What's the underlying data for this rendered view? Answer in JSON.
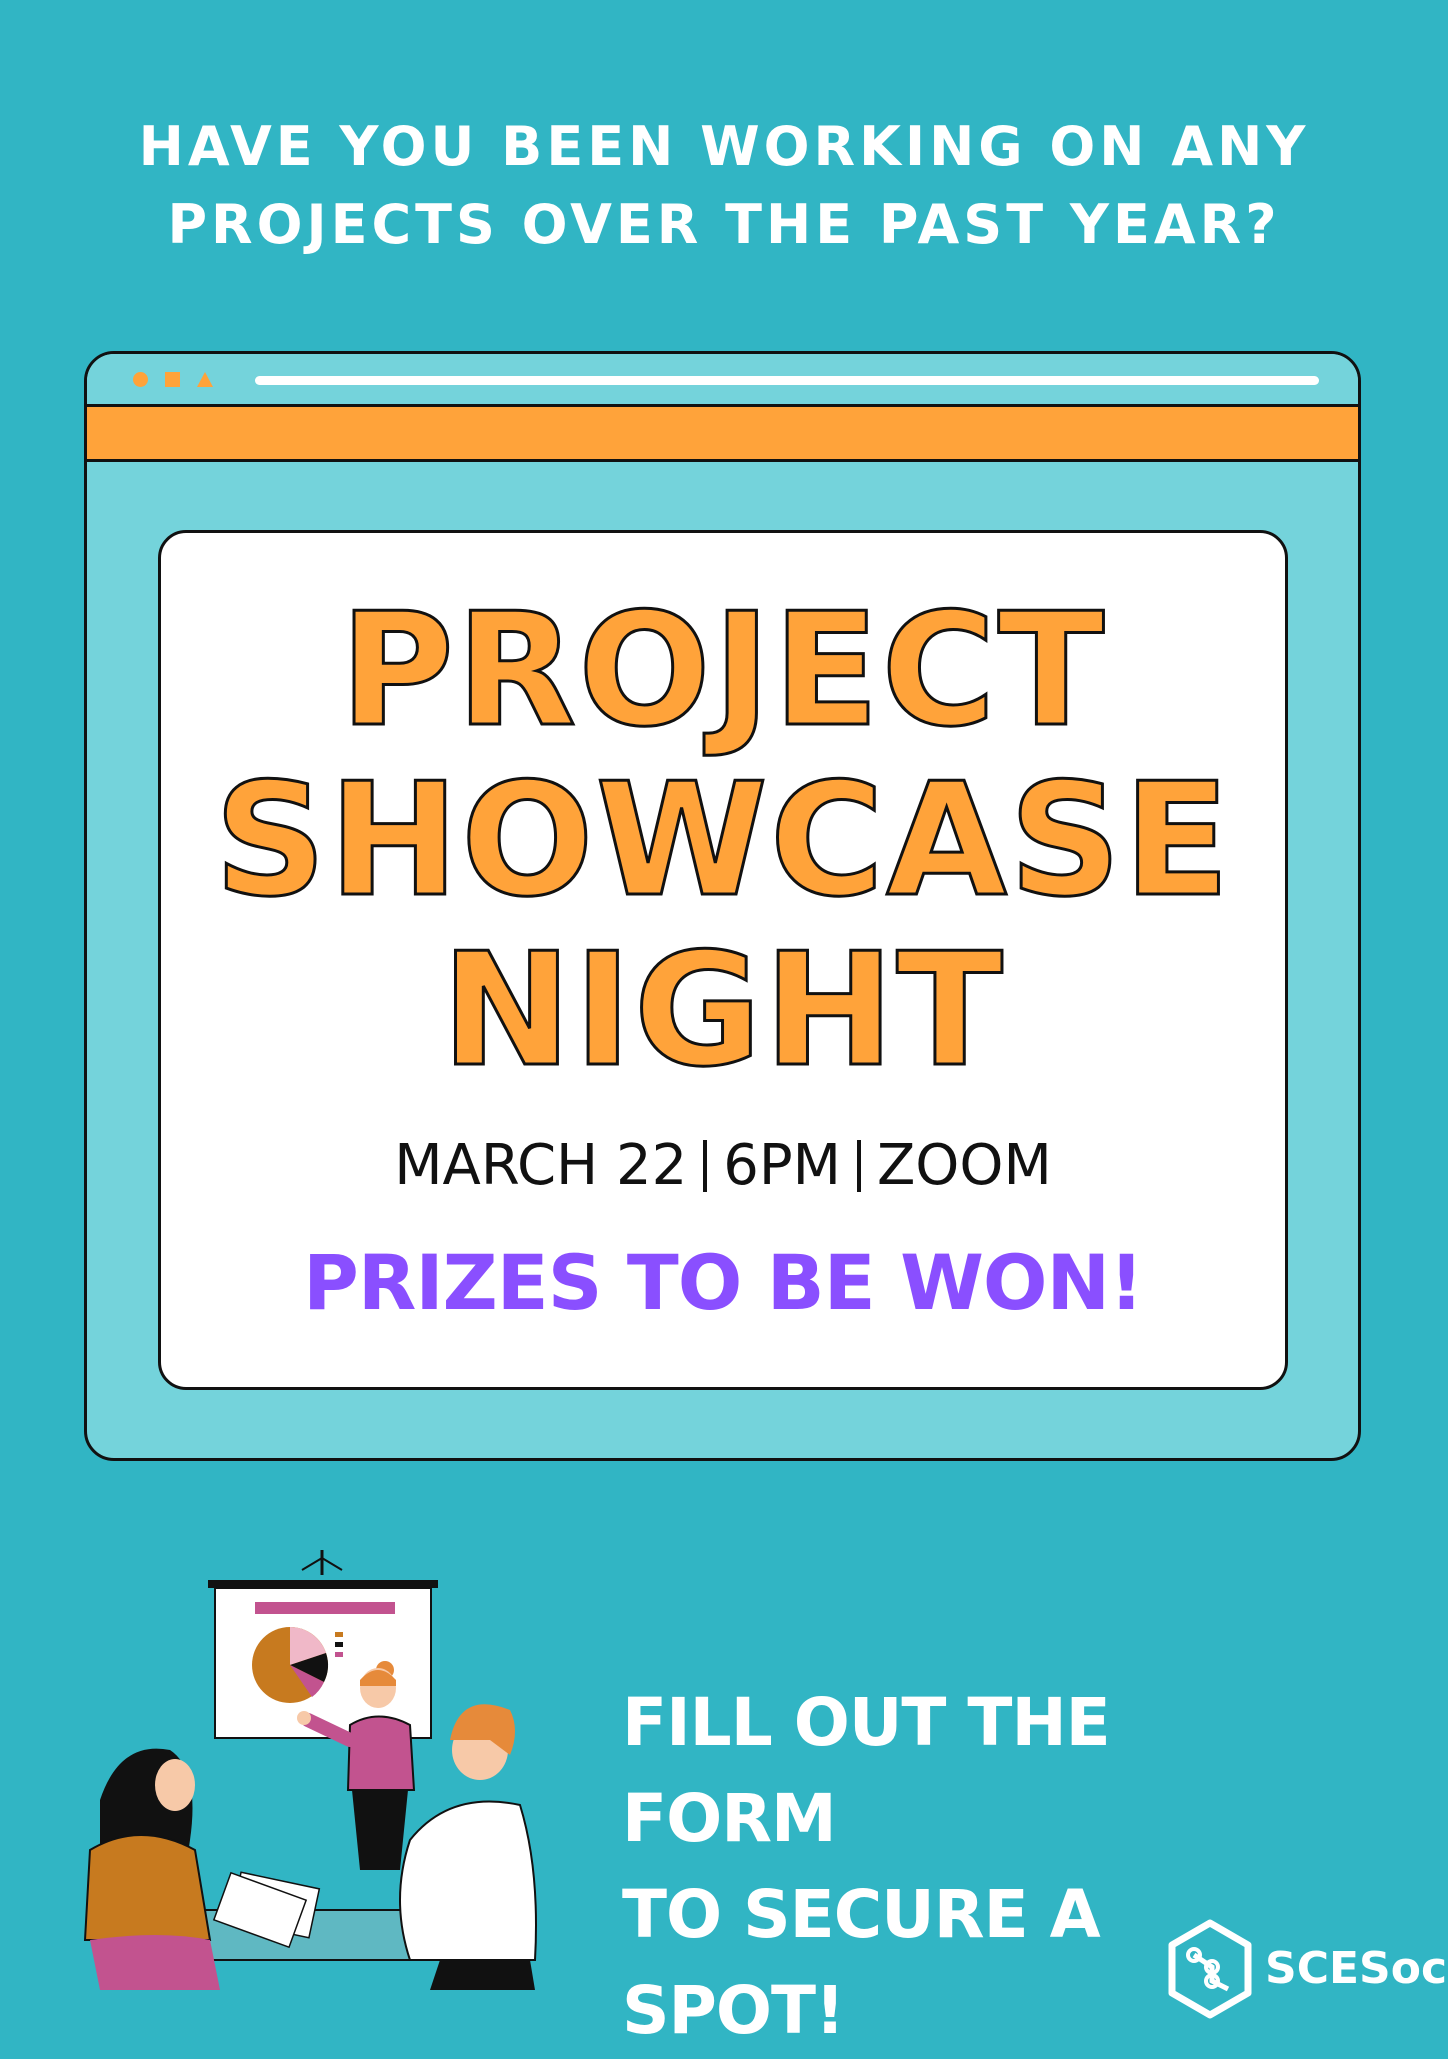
{
  "poster": {
    "question_line1": "HAVE YOU BEEN WORKING ON ANY",
    "question_line2": "PROJECTS OVER THE PAST YEAR?",
    "title_line1": "PROJECT",
    "title_line2": "SHOWCASE",
    "title_line3": "NIGHT",
    "date": "MARCH 22",
    "time": "6PM",
    "location": "ZOOM",
    "prizes": "PRIZES TO BE WON!",
    "cta_line1": "FILL OUT THE FORM",
    "cta_line2": "TO SECURE A SPOT!",
    "logo_text": "SCESoc"
  },
  "colors": {
    "background": "#31b5c4",
    "window": "#74d3db",
    "accent_orange": "#ffa33a",
    "accent_purple": "#8a4fff",
    "text_dark": "#111111",
    "text_light": "#ffffff"
  },
  "icons": [
    "circle-icon",
    "square-icon",
    "triangle-icon",
    "scesoc-logo-icon"
  ]
}
